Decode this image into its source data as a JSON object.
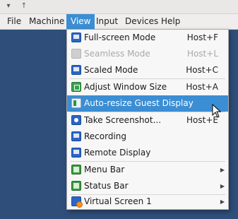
{
  "titlebar": {
    "collapse_glyph": "▾",
    "pin_glyph": "↑"
  },
  "menubar": {
    "items": [
      "File",
      "Machine",
      "View",
      "Input",
      "Devices",
      "Help"
    ],
    "active": "View"
  },
  "view_menu": {
    "items": [
      {
        "label": "Full-screen Mode",
        "shortcut": "Host+F",
        "icon": "fullscreen-icon"
      },
      {
        "label": "Seamless Mode",
        "shortcut": "Host+L",
        "icon": "seamless-icon",
        "disabled": true
      },
      {
        "label": "Scaled Mode",
        "shortcut": "Host+C",
        "icon": "scaled-icon"
      },
      {
        "label": "Adjust Window Size",
        "shortcut": "Host+A",
        "icon": "adjust-window-icon"
      },
      {
        "label": "Auto-resize Guest Display",
        "shortcut": "",
        "icon": "auto-resize-icon",
        "highlighted": true
      },
      {
        "label": "Take Screenshot...",
        "shortcut": "Host+E",
        "icon": "screenshot-icon"
      },
      {
        "label": "Recording",
        "shortcut": "",
        "icon": "recording-icon"
      },
      {
        "label": "Remote Display",
        "shortcut": "",
        "icon": "remote-display-icon"
      },
      {
        "label": "Menu Bar",
        "submenu": true,
        "icon": "menu-bar-icon"
      },
      {
        "label": "Status Bar",
        "submenu": true,
        "icon": "status-bar-icon"
      },
      {
        "label": "Virtual Screen 1",
        "submenu": true,
        "icon": "virtual-screen-icon"
      }
    ],
    "submenu_arrow": "▶"
  },
  "colors": {
    "accent": "#3b8ed3",
    "vm_background": "#2f4f7a"
  }
}
